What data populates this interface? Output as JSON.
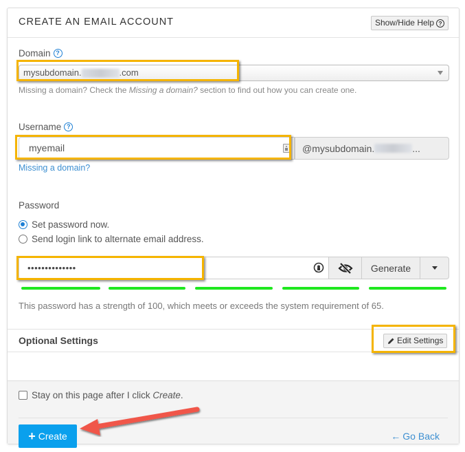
{
  "panel": {
    "title": "CREATE AN EMAIL ACCOUNT",
    "help_button": "Show/Hide Help",
    "help_icon": "question-circle-icon"
  },
  "domain": {
    "label": "Domain",
    "help_icon": "question-circle-icon",
    "selected_prefix": "mysubdomain.",
    "selected_suffix": ".com",
    "redacted": true,
    "help_before": "Missing a domain? Check the ",
    "help_italic": "Missing a domain?",
    "help_after": " section to find out how you can create one."
  },
  "username": {
    "label": "Username",
    "help_icon": "question-circle-icon",
    "value": "myemail",
    "addon_prefix": "@mysubdomain.",
    "addon_suffix": "...",
    "missing_link": "Missing a domain?"
  },
  "password": {
    "label": "Password",
    "options": [
      {
        "label": "Set password now.",
        "checked": true
      },
      {
        "label": "Send login link to alternate email address.",
        "checked": false
      }
    ],
    "masked_value": "••••••••••••••",
    "generate_label": "Generate",
    "strength_segments_filled": 5,
    "strength_segments_total": 5,
    "strength_color": "#1fe81f",
    "strength_text": "This password has a strength of 100, which meets or exceeds the system requirement of 65."
  },
  "optional": {
    "title": "Optional Settings",
    "edit_button": "Edit Settings"
  },
  "footer": {
    "stay_before": "Stay on this page after I click ",
    "stay_italic": "Create",
    "stay_after": ".",
    "stay_checked": false,
    "create_label": "Create",
    "go_back_label": "Go Back"
  },
  "colors": {
    "accent": "#0aa0ed",
    "link": "#3d8fd1",
    "highlight": "#f5b400",
    "annotation_arrow": "#f0564a"
  }
}
